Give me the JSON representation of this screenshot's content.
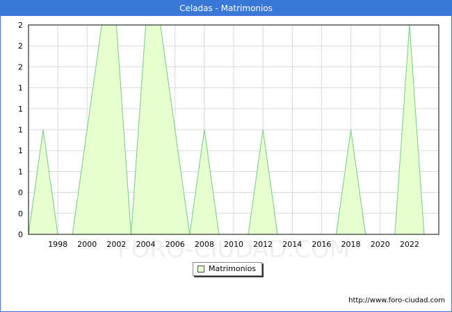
{
  "header": {
    "title": "Celadas - Matrimonios"
  },
  "watermark": "FORO-CIUDAD.COM",
  "footer": {
    "source": "http://www.foro-ciudad.com"
  },
  "colors": {
    "header": "#3a78d8",
    "area_fill": "#e8ffd0",
    "area_line": "#6fcf84",
    "grid": "#d9d9d9"
  },
  "chart_data": {
    "type": "area",
    "title": "Celadas - Matrimonios",
    "xlabel": "",
    "ylabel": "",
    "xlim": [
      1996,
      2024
    ],
    "ylim": [
      0,
      2
    ],
    "grid": true,
    "legend_position": "bottom-center",
    "x_ticks": [
      1998,
      2000,
      2002,
      2004,
      2006,
      2008,
      2010,
      2012,
      2014,
      2016,
      2018,
      2020,
      2022
    ],
    "y_tick_labels": [
      "0",
      "0",
      "0",
      "1",
      "1",
      "1",
      "1",
      "1",
      "2",
      "2",
      "2"
    ],
    "series": [
      {
        "name": "Matrimonios",
        "x": [
          1996,
          1997,
          1998,
          1999,
          2000,
          2001,
          2002,
          2003,
          2004,
          2005,
          2006,
          2007,
          2008,
          2009,
          2010,
          2011,
          2012,
          2013,
          2014,
          2015,
          2016,
          2017,
          2018,
          2019,
          2020,
          2021,
          2022,
          2023
        ],
        "values": [
          0,
          1,
          0,
          0,
          1,
          2,
          2,
          0,
          2,
          2,
          1,
          0,
          1,
          0,
          0,
          0,
          1,
          0,
          0,
          0,
          0,
          0,
          1,
          0,
          0,
          0,
          2,
          0
        ]
      }
    ]
  }
}
